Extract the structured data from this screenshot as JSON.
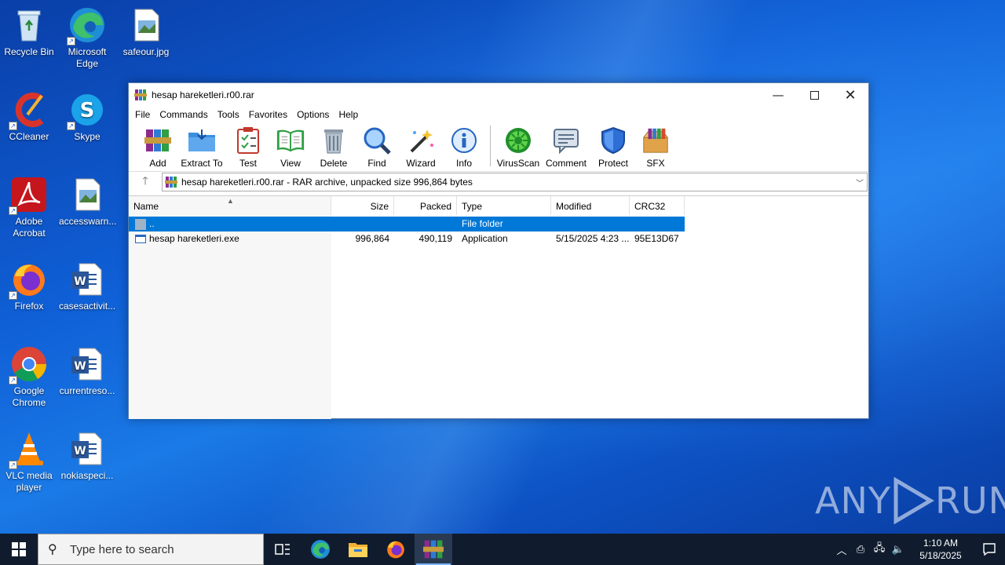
{
  "desktop": {
    "icons": [
      {
        "label": "Recycle Bin"
      },
      {
        "label": "Microsoft Edge"
      },
      {
        "label": "safeour.jpg"
      },
      {
        "label": "CCleaner"
      },
      {
        "label": "Skype"
      },
      {
        "label": "Adobe Acrobat"
      },
      {
        "label": "accesswarn..."
      },
      {
        "label": "Firefox"
      },
      {
        "label": "casesactivit..."
      },
      {
        "label": "Google Chrome"
      },
      {
        "label": "currentreso..."
      },
      {
        "label": "VLC media player"
      },
      {
        "label": "nokiaspeci..."
      }
    ]
  },
  "window": {
    "title": "hesap hareketleri.r00.rar",
    "menu": [
      "File",
      "Commands",
      "Tools",
      "Favorites",
      "Options",
      "Help"
    ],
    "toolbar": [
      "Add",
      "Extract To",
      "Test",
      "View",
      "Delete",
      "Find",
      "Wizard",
      "Info",
      "VirusScan",
      "Comment",
      "Protect",
      "SFX"
    ],
    "address": "hesap hareketleri.r00.rar - RAR archive, unpacked size 996,864 bytes",
    "columns": {
      "name": "Name",
      "size": "Size",
      "packed": "Packed",
      "type": "Type",
      "modified": "Modified",
      "crc": "CRC32"
    },
    "rows": [
      {
        "name": "..",
        "size": "",
        "packed": "",
        "type": "File folder",
        "modified": "",
        "crc": ""
      },
      {
        "name": "hesap hareketleri.exe",
        "size": "996,864",
        "packed": "490,119",
        "type": "Application",
        "modified": "5/15/2025 4:23 ...",
        "crc": "95E13D67"
      }
    ]
  },
  "taskbar": {
    "search_placeholder": "Type here to search",
    "time": "1:10 AM",
    "date": "5/18/2025"
  },
  "watermark": {
    "left": "ANY",
    "right": "RUN"
  }
}
